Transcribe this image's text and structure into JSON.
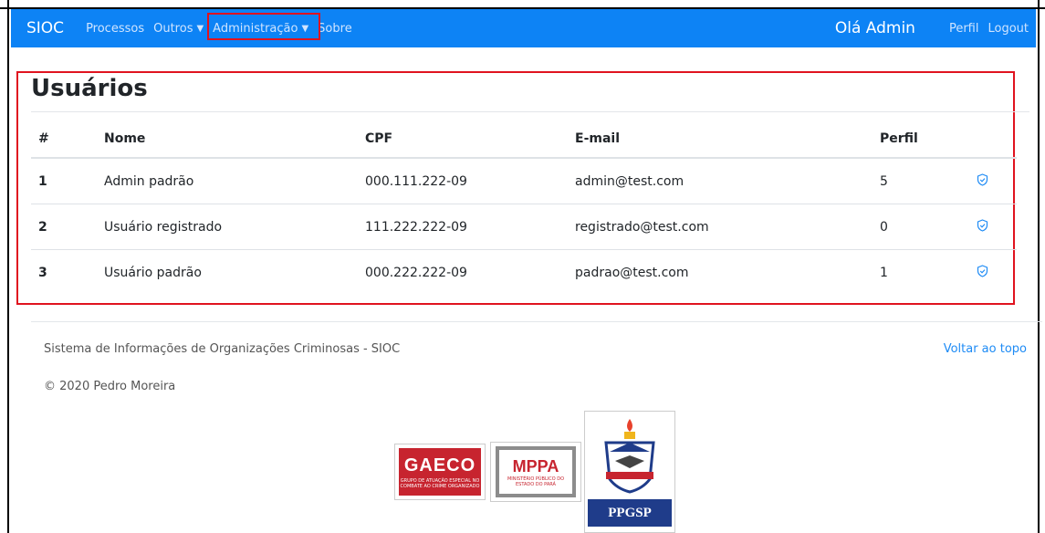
{
  "navbar": {
    "brand": "SIOC",
    "items": [
      {
        "label": "Processos"
      },
      {
        "label": "Outros"
      },
      {
        "label": "Administração"
      },
      {
        "label": "Sobre"
      }
    ],
    "greeting": "Olá Admin",
    "profile_link": "Perfil",
    "logout_link": "Logout",
    "color": "#0d83f5"
  },
  "page": {
    "title": "Usuários"
  },
  "table": {
    "headers": [
      "#",
      "Nome",
      "CPF",
      "E-mail",
      "Perfil"
    ],
    "rows": [
      {
        "num": "1",
        "nome": "Admin padrão",
        "cpf": "000.111.222-09",
        "email": "admin@test.com",
        "perfil": "5",
        "action_icon": "shield-check-icon"
      },
      {
        "num": "2",
        "nome": "Usuário registrado",
        "cpf": "111.222.222-09",
        "email": "registrado@test.com",
        "perfil": "0",
        "action_icon": "shield-check-icon"
      },
      {
        "num": "3",
        "nome": "Usuário padrão",
        "cpf": "000.222.222-09",
        "email": "padrao@test.com",
        "perfil": "1",
        "action_icon": "shield-check-icon"
      }
    ]
  },
  "footer": {
    "system_name": "Sistema de Informações de Organizações Criminosas - SIOC",
    "copyright": "© 2020 Pedro Moreira",
    "back_to_top": "Voltar ao topo"
  },
  "logos": {
    "gaeco": {
      "name": "GAECO",
      "subtitle": "GRUPO DE ATUAÇÃO ESPECIAL NO COMBATE AO CRIME ORGANIZADO"
    },
    "mppa": {
      "name": "MPPA",
      "subtitle": "MINISTÉRIO PÚBLICO DO ESTADO DO PARÁ"
    },
    "ppgsp": {
      "name": "PPGSP"
    }
  },
  "highlight_color": "#e0131f"
}
